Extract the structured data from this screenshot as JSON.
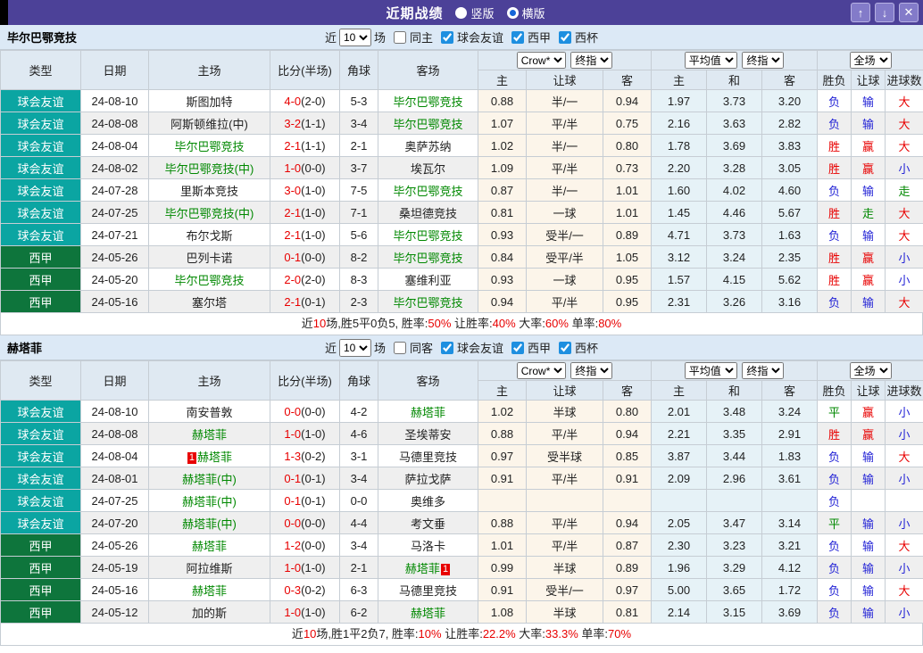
{
  "titlebar": {
    "title": "近期战绩",
    "vertical": "竖版",
    "horizontal": "横版",
    "up": "↑",
    "down": "↓",
    "close": "✕"
  },
  "colors": {
    "titlebar_purple": "#4c4198",
    "friendly_teal": "#0ba5a2",
    "laliga_green": "#0e753c",
    "win_red": "#e80000",
    "lose_blue": "#2323d6",
    "draw_green": "#008800",
    "odds_bg": "#fcf5ea",
    "avg_bg": "#e6f2f7"
  },
  "table_header": {
    "cols": [
      "类型",
      "日期",
      "主场",
      "比分(半场)",
      "角球",
      "客场"
    ],
    "sub": [
      "主",
      "让球",
      "客",
      "主",
      "和",
      "客",
      "胜负",
      "让球",
      "进球数"
    ],
    "selects": {
      "provider": "Crow*",
      "final1": "终指",
      "average": "平均值",
      "final2": "终指",
      "fulltime": "全场"
    }
  },
  "sections": [
    {
      "team": "毕尔巴鄂竞技",
      "filter": {
        "near": "近",
        "count": "10",
        "games": "场",
        "same_label": "同主",
        "same_checked": false,
        "leagues": [
          "球会友谊",
          "西甲",
          "西杯"
        ]
      },
      "rows": [
        {
          "t": "球会友谊",
          "lg": "f",
          "d": "24-08-10",
          "h": "斯图加特",
          "hg": 0,
          "hb": "",
          "s": "4-0",
          "hf": "(2-0)",
          "c": "5-3",
          "a": "毕尔巴鄂竞技",
          "ag": 1,
          "ab": "",
          "o": [
            "0.88",
            "半/一",
            "0.94"
          ],
          "v": [
            "1.97",
            "3.73",
            "3.20"
          ],
          "r": [
            "负",
            "输",
            "大"
          ]
        },
        {
          "t": "球会友谊",
          "lg": "f",
          "d": "24-08-08",
          "h": "阿斯顿维拉(中)",
          "hg": 0,
          "hb": "",
          "s": "3-2",
          "hf": "(1-1)",
          "c": "3-4",
          "a": "毕尔巴鄂竞技",
          "ag": 1,
          "ab": "",
          "o": [
            "1.07",
            "平/半",
            "0.75"
          ],
          "v": [
            "2.16",
            "3.63",
            "2.82"
          ],
          "r": [
            "负",
            "输",
            "大"
          ]
        },
        {
          "t": "球会友谊",
          "lg": "f",
          "d": "24-08-04",
          "h": "毕尔巴鄂竞技",
          "hg": 1,
          "hb": "",
          "s": "2-1",
          "hf": "(1-1)",
          "c": "2-1",
          "a": "奥萨苏纳",
          "ag": 0,
          "ab": "",
          "o": [
            "1.02",
            "半/一",
            "0.80"
          ],
          "v": [
            "1.78",
            "3.69",
            "3.83"
          ],
          "r": [
            "胜",
            "赢",
            "大"
          ]
        },
        {
          "t": "球会友谊",
          "lg": "f",
          "d": "24-08-02",
          "h": "毕尔巴鄂竞技(中)",
          "hg": 1,
          "hb": "",
          "s": "1-0",
          "hf": "(0-0)",
          "c": "3-7",
          "a": "埃瓦尔",
          "ag": 0,
          "ab": "",
          "o": [
            "1.09",
            "平/半",
            "0.73"
          ],
          "v": [
            "2.20",
            "3.28",
            "3.05"
          ],
          "r": [
            "胜",
            "赢",
            "小"
          ]
        },
        {
          "t": "球会友谊",
          "lg": "f",
          "d": "24-07-28",
          "h": "里斯本竞技",
          "hg": 0,
          "hb": "",
          "s": "3-0",
          "hf": "(1-0)",
          "c": "7-5",
          "a": "毕尔巴鄂竞技",
          "ag": 1,
          "ab": "",
          "o": [
            "0.87",
            "半/一",
            "1.01"
          ],
          "v": [
            "1.60",
            "4.02",
            "4.60"
          ],
          "r": [
            "负",
            "输",
            "走"
          ]
        },
        {
          "t": "球会友谊",
          "lg": "f",
          "d": "24-07-25",
          "h": "毕尔巴鄂竞技(中)",
          "hg": 1,
          "hb": "",
          "s": "2-1",
          "hf": "(1-0)",
          "c": "7-1",
          "a": "桑坦德竞技",
          "ag": 0,
          "ab": "",
          "o": [
            "0.81",
            "一球",
            "1.01"
          ],
          "v": [
            "1.45",
            "4.46",
            "5.67"
          ],
          "r": [
            "胜",
            "走",
            "大"
          ]
        },
        {
          "t": "球会友谊",
          "lg": "f",
          "d": "24-07-21",
          "h": "布尔戈斯",
          "hg": 0,
          "hb": "",
          "s": "2-1",
          "hf": "(1-0)",
          "c": "5-6",
          "a": "毕尔巴鄂竞技",
          "ag": 1,
          "ab": "",
          "o": [
            "0.93",
            "受半/一",
            "0.89"
          ],
          "v": [
            "4.71",
            "3.73",
            "1.63"
          ],
          "r": [
            "负",
            "输",
            "大"
          ]
        },
        {
          "t": "西甲",
          "lg": "l",
          "d": "24-05-26",
          "h": "巴列卡诺",
          "hg": 0,
          "hb": "",
          "s": "0-1",
          "hf": "(0-0)",
          "c": "8-2",
          "a": "毕尔巴鄂竞技",
          "ag": 1,
          "ab": "",
          "o": [
            "0.84",
            "受平/半",
            "1.05"
          ],
          "v": [
            "3.12",
            "3.24",
            "2.35"
          ],
          "r": [
            "胜",
            "赢",
            "小"
          ]
        },
        {
          "t": "西甲",
          "lg": "l",
          "d": "24-05-20",
          "h": "毕尔巴鄂竞技",
          "hg": 1,
          "hb": "",
          "s": "2-0",
          "hf": "(2-0)",
          "c": "8-3",
          "a": "塞维利亚",
          "ag": 0,
          "ab": "",
          "o": [
            "0.93",
            "一球",
            "0.95"
          ],
          "v": [
            "1.57",
            "4.15",
            "5.62"
          ],
          "r": [
            "胜",
            "赢",
            "小"
          ]
        },
        {
          "t": "西甲",
          "lg": "l",
          "d": "24-05-16",
          "h": "塞尔塔",
          "hg": 0,
          "hb": "",
          "s": "2-1",
          "hf": "(0-1)",
          "c": "2-3",
          "a": "毕尔巴鄂竞技",
          "ag": 1,
          "ab": "",
          "o": [
            "0.94",
            "平/半",
            "0.95"
          ],
          "v": [
            "2.31",
            "3.26",
            "3.16"
          ],
          "r": [
            "负",
            "输",
            "大"
          ]
        }
      ],
      "summary_parts": [
        {
          "t": "近"
        },
        {
          "t": "10",
          "red": true
        },
        {
          "t": "场,胜5平0负5, 胜率:"
        },
        {
          "t": "50%",
          "red": true
        },
        {
          "t": " 让胜率:"
        },
        {
          "t": "40%",
          "red": true
        },
        {
          "t": " 大率:"
        },
        {
          "t": "60%",
          "red": true
        },
        {
          "t": " 单率:"
        },
        {
          "t": "80%",
          "red": true
        }
      ]
    },
    {
      "team": "赫塔菲",
      "filter": {
        "near": "近",
        "count": "10",
        "games": "场",
        "same_label": "同客",
        "same_checked": false,
        "leagues": [
          "球会友谊",
          "西甲",
          "西杯"
        ]
      },
      "rows": [
        {
          "t": "球会友谊",
          "lg": "f",
          "d": "24-08-10",
          "h": "南安普敦",
          "hg": 0,
          "hb": "",
          "s": "0-0",
          "hf": "(0-0)",
          "c": "4-2",
          "a": "赫塔菲",
          "ag": 1,
          "ab": "",
          "o": [
            "1.02",
            "半球",
            "0.80"
          ],
          "v": [
            "2.01",
            "3.48",
            "3.24"
          ],
          "r": [
            "平",
            "赢",
            "小"
          ]
        },
        {
          "t": "球会友谊",
          "lg": "f",
          "d": "24-08-08",
          "h": "赫塔菲",
          "hg": 1,
          "hb": "",
          "s": "1-0",
          "hf": "(1-0)",
          "c": "4-6",
          "a": "圣埃蒂安",
          "ag": 0,
          "ab": "",
          "o": [
            "0.88",
            "平/半",
            "0.94"
          ],
          "v": [
            "2.21",
            "3.35",
            "2.91"
          ],
          "r": [
            "胜",
            "赢",
            "小"
          ]
        },
        {
          "t": "球会友谊",
          "lg": "f",
          "d": "24-08-04",
          "h": "赫塔菲",
          "hg": 1,
          "hb": "1",
          "s": "1-3",
          "hf": "(0-2)",
          "c": "3-1",
          "a": "马德里竞技",
          "ag": 0,
          "ab": "",
          "o": [
            "0.97",
            "受半球",
            "0.85"
          ],
          "v": [
            "3.87",
            "3.44",
            "1.83"
          ],
          "r": [
            "负",
            "输",
            "大"
          ]
        },
        {
          "t": "球会友谊",
          "lg": "f",
          "d": "24-08-01",
          "h": "赫塔菲(中)",
          "hg": 1,
          "hb": "",
          "s": "0-1",
          "hf": "(0-1)",
          "c": "3-4",
          "a": "萨拉戈萨",
          "ag": 0,
          "ab": "",
          "o": [
            "0.91",
            "平/半",
            "0.91"
          ],
          "v": [
            "2.09",
            "2.96",
            "3.61"
          ],
          "r": [
            "负",
            "输",
            "小"
          ]
        },
        {
          "t": "球会友谊",
          "lg": "f",
          "d": "24-07-25",
          "h": "赫塔菲(中)",
          "hg": 1,
          "hb": "",
          "s": "0-1",
          "hf": "(0-1)",
          "c": "0-0",
          "a": "奥维多",
          "ag": 0,
          "ab": "",
          "o": [
            "",
            "",
            ""
          ],
          "v": [
            "",
            "",
            ""
          ],
          "r": [
            "负",
            "",
            ""
          ]
        },
        {
          "t": "球会友谊",
          "lg": "f",
          "d": "24-07-20",
          "h": "赫塔菲(中)",
          "hg": 1,
          "hb": "",
          "s": "0-0",
          "hf": "(0-0)",
          "c": "4-4",
          "a": "考文垂",
          "ag": 0,
          "ab": "",
          "o": [
            "0.88",
            "平/半",
            "0.94"
          ],
          "v": [
            "2.05",
            "3.47",
            "3.14"
          ],
          "r": [
            "平",
            "输",
            "小"
          ]
        },
        {
          "t": "西甲",
          "lg": "l",
          "d": "24-05-26",
          "h": "赫塔菲",
          "hg": 1,
          "hb": "",
          "s": "1-2",
          "hf": "(0-0)",
          "c": "3-4",
          "a": "马洛卡",
          "ag": 0,
          "ab": "",
          "o": [
            "1.01",
            "平/半",
            "0.87"
          ],
          "v": [
            "2.30",
            "3.23",
            "3.21"
          ],
          "r": [
            "负",
            "输",
            "大"
          ]
        },
        {
          "t": "西甲",
          "lg": "l",
          "d": "24-05-19",
          "h": "阿拉维斯",
          "hg": 0,
          "hb": "",
          "s": "1-0",
          "hf": "(1-0)",
          "c": "2-1",
          "a": "赫塔菲",
          "ag": 1,
          "ab": "1",
          "o": [
            "0.99",
            "半球",
            "0.89"
          ],
          "v": [
            "1.96",
            "3.29",
            "4.12"
          ],
          "r": [
            "负",
            "输",
            "小"
          ]
        },
        {
          "t": "西甲",
          "lg": "l",
          "d": "24-05-16",
          "h": "赫塔菲",
          "hg": 1,
          "hb": "",
          "s": "0-3",
          "hf": "(0-2)",
          "c": "6-3",
          "a": "马德里竞技",
          "ag": 0,
          "ab": "",
          "o": [
            "0.91",
            "受半/一",
            "0.97"
          ],
          "v": [
            "5.00",
            "3.65",
            "1.72"
          ],
          "r": [
            "负",
            "输",
            "大"
          ]
        },
        {
          "t": "西甲",
          "lg": "l",
          "d": "24-05-12",
          "h": "加的斯",
          "hg": 0,
          "hb": "",
          "s": "1-0",
          "hf": "(1-0)",
          "c": "6-2",
          "a": "赫塔菲",
          "ag": 1,
          "ab": "",
          "o": [
            "1.08",
            "半球",
            "0.81"
          ],
          "v": [
            "2.14",
            "3.15",
            "3.69"
          ],
          "r": [
            "负",
            "输",
            "小"
          ]
        }
      ],
      "summary_parts": [
        {
          "t": "近"
        },
        {
          "t": "10",
          "red": true
        },
        {
          "t": "场,胜1平2负7, 胜率:"
        },
        {
          "t": "10%",
          "red": true
        },
        {
          "t": " 让胜率:"
        },
        {
          "t": "22.2%",
          "red": true
        },
        {
          "t": " 大率:"
        },
        {
          "t": "33.3%",
          "red": true
        },
        {
          "t": " 单率:"
        },
        {
          "t": "70%",
          "red": true
        }
      ]
    }
  ]
}
